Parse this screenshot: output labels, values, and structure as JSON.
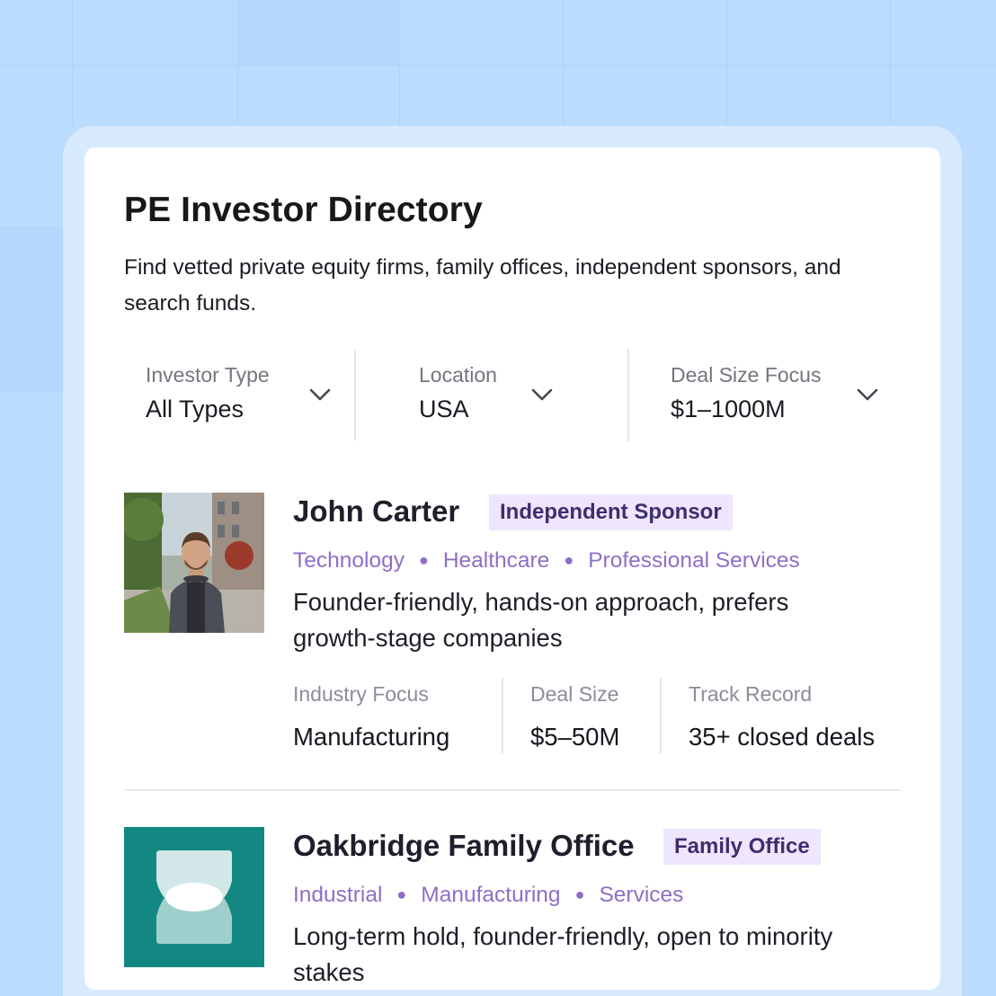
{
  "header": {
    "title": "PE Investor Directory",
    "subtitle": "Find vetted private equity firms, family offices, independent sponsors, and search funds."
  },
  "filters": [
    {
      "label": "Investor Type",
      "value": "All Types",
      "icon": "chevron-down-icon"
    },
    {
      "label": "Location",
      "value": "USA",
      "icon": "chevron-down-icon"
    },
    {
      "label": "Deal Size Focus",
      "value": "$1–1000M",
      "icon": "chevron-down-icon"
    }
  ],
  "investors": [
    {
      "name": "John Carter",
      "badge": "Independent Sponsor",
      "tags": [
        "Technology",
        "Healthcare",
        "Professional Services"
      ],
      "description": "Founder-friendly, hands-on approach, prefers growth-stage companies",
      "stats": [
        {
          "label": "Industry Focus",
          "value": "Manufacturing"
        },
        {
          "label": "Deal Size",
          "value": "$5–50M"
        },
        {
          "label": "Track Record",
          "value": "35+ closed deals"
        }
      ],
      "avatar": "person-photo"
    },
    {
      "name": "Oakbridge Family Office",
      "badge": "Family Office",
      "tags": [
        "Industrial",
        "Manufacturing",
        "Services"
      ],
      "description": "Long-term hold, founder-friendly, open to minority stakes",
      "avatar": "hourglass-logo"
    }
  ],
  "colors": {
    "background": "#bcdcfd",
    "frame": "#d8eafe",
    "badge_bg": "#ede6fd",
    "tag_text": "#8e6fc4",
    "logo_teal": "#138882"
  }
}
